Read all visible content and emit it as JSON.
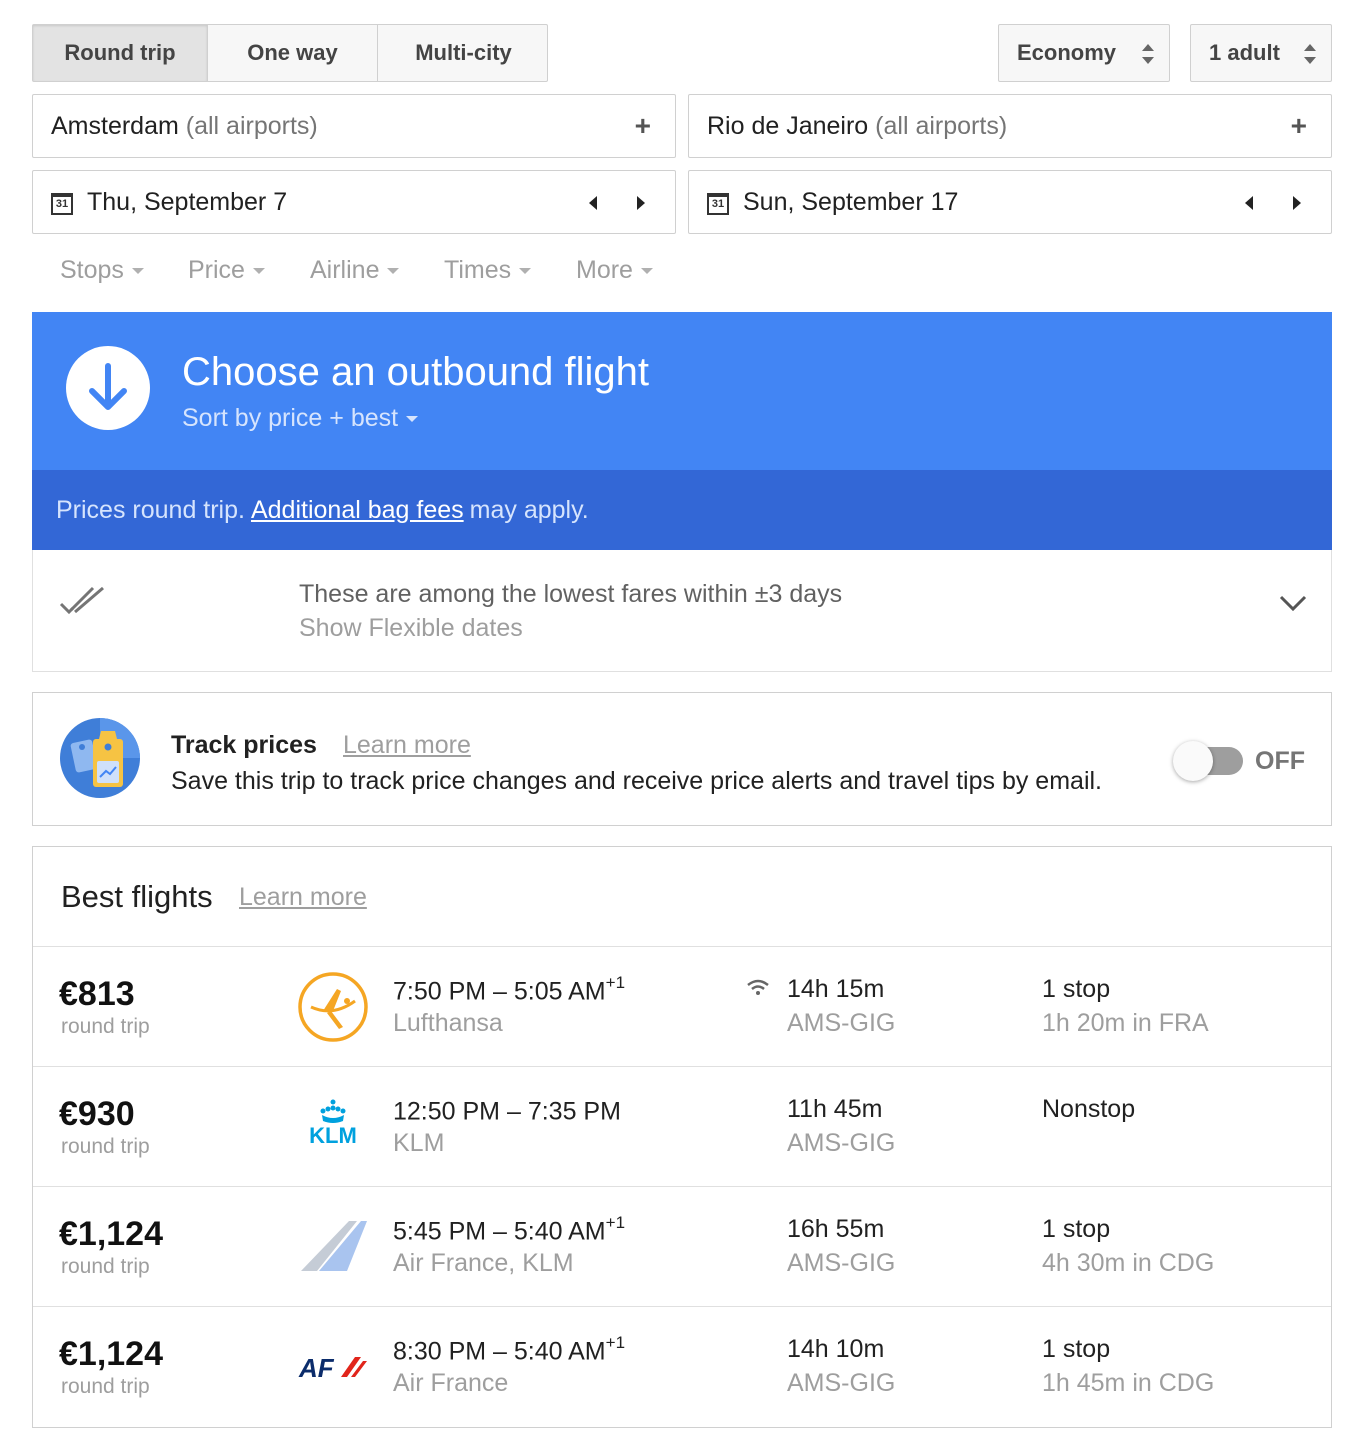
{
  "trip_type": {
    "options": [
      "Round trip",
      "One way",
      "Multi-city"
    ],
    "selected": "Round trip"
  },
  "cabin_class": "Economy",
  "passengers": "1 adult",
  "origin": {
    "city": "Amsterdam",
    "qualifier": "(all airports)"
  },
  "destination": {
    "city": "Rio de Janeiro",
    "qualifier": "(all airports)"
  },
  "depart_date": "Thu, September 7",
  "return_date": "Sun, September 17",
  "calendar_icon_text": "31",
  "filters": [
    "Stops",
    "Price",
    "Airline",
    "Times",
    "More"
  ],
  "banner": {
    "title": "Choose an outbound flight",
    "sort_label": "Sort by price + best",
    "note_prefix": "Prices round trip.",
    "note_link": "Additional bag fees",
    "note_suffix": "may apply.",
    "color": "#4285f4",
    "subcolor": "#3367d6"
  },
  "flexible_dates": {
    "message": "These are among the lowest fares within ±3 days",
    "link": "Show Flexible dates"
  },
  "track_prices": {
    "title": "Track prices",
    "learn_more": "Learn more",
    "description": "Save this trip to track price changes and receive price alerts and travel tips by email.",
    "toggle_state": "OFF"
  },
  "best_flights": {
    "title": "Best flights",
    "learn_more": "Learn more",
    "flights": [
      {
        "price": "€813",
        "price_note": "round trip",
        "logo": "lufthansa-logo",
        "depart": "7:50 PM",
        "arrive": "5:05 AM",
        "day_offset": "+1",
        "airline": "Lufthansa",
        "wifi": true,
        "duration": "14h 15m",
        "route": "AMS-GIG",
        "stops": "1 stop",
        "layover": "1h 20m in FRA"
      },
      {
        "price": "€930",
        "price_note": "round trip",
        "logo": "klm-logo",
        "depart": "12:50 PM",
        "arrive": "7:35 PM",
        "day_offset": "",
        "airline": "KLM",
        "wifi": false,
        "duration": "11h 45m",
        "route": "AMS-GIG",
        "stops": "Nonstop",
        "layover": ""
      },
      {
        "price": "€1,124",
        "price_note": "round trip",
        "logo": "multi-airline-logo",
        "depart": "5:45 PM",
        "arrive": "5:40 AM",
        "day_offset": "+1",
        "airline": "Air France, KLM",
        "wifi": false,
        "duration": "16h 55m",
        "route": "AMS-GIG",
        "stops": "1 stop",
        "layover": "4h 30m in CDG"
      },
      {
        "price": "€1,124",
        "price_note": "round trip",
        "logo": "air-france-logo",
        "depart": "8:30 PM",
        "arrive": "5:40 AM",
        "day_offset": "+1",
        "airline": "Air France",
        "wifi": false,
        "duration": "14h 10m",
        "route": "AMS-GIG",
        "stops": "1 stop",
        "layover": "1h 45m in CDG"
      }
    ]
  }
}
